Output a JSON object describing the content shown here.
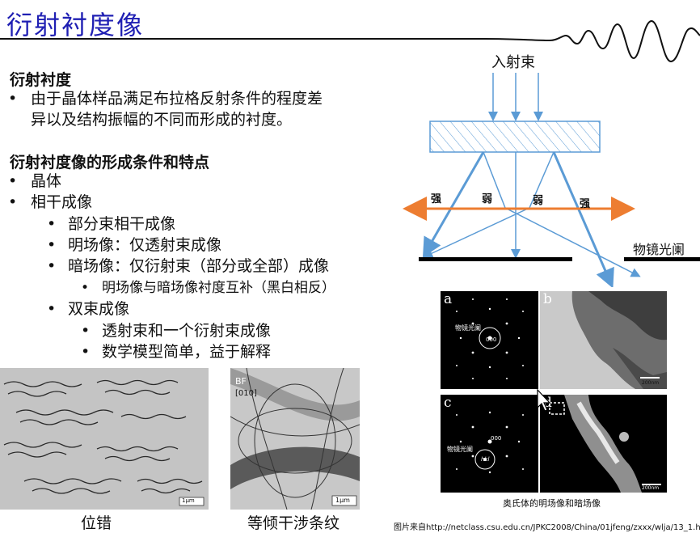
{
  "title": "衍射衬度像",
  "section1": {
    "heading": "衍射衬度",
    "bullet_line1": "由于晶体样品满足布拉格反射条件的程度差",
    "bullet_line2": "异以及结构振幅的不同而形成的衬度。"
  },
  "section2": {
    "heading": "衍射衬度像的形成条件和特点",
    "items": [
      "晶体",
      "相干成像",
      "部分束相干成像",
      "明场像：仅透射束成像",
      "暗场像：仅衍射束（部分或全部）成像",
      "明场像与暗场像衬度互补（黑白相反）",
      "双束成像",
      "透射束和一个衍射束成像",
      "数学模型简单，益于解释"
    ]
  },
  "diagram": {
    "incident_label": "入射束",
    "strong_left": "强",
    "weak_left": "弱",
    "weak_right": "弱",
    "strong_right": "强",
    "aperture_label": "物镜光阑",
    "beam_color": "#5b9bd5",
    "axis_color": "#ed7d31"
  },
  "micrographs": {
    "a": "a",
    "b": "b",
    "c": "c",
    "d": "d",
    "aperture_small": "物镜光阑",
    "index_000": "000",
    "index_hkl": "hkl",
    "scale_b": "200nm",
    "scale_d": "200nm",
    "caption": "奥氏体的明场像和暗场像"
  },
  "bottom_left": {
    "dislocation_caption": "位错",
    "fringe_caption": "等倾干涉条纹",
    "bf_label": "BF",
    "zone_label": "[010]",
    "scale_label": "1μm",
    "scale_left": "1μm"
  },
  "source_text": "图片来自http://netclass.csu.edu.cn/JPKC2008/China/01jfeng/zxxx/wlja/13_1.html"
}
